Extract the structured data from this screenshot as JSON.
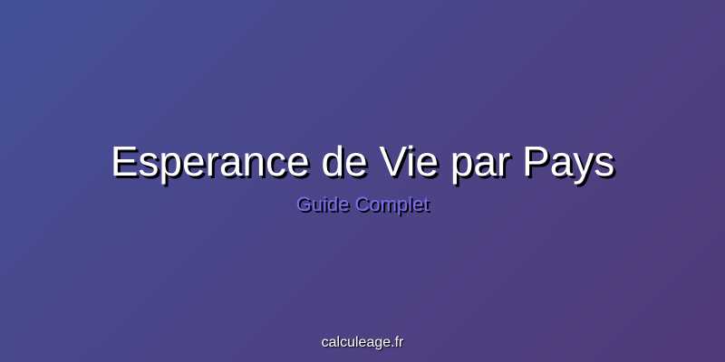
{
  "title": "Esperance de Vie par Pays",
  "subtitle": "Guide Complet",
  "footer": "calculeage.fr",
  "colors": {
    "background_start": "#44519a",
    "background_end": "#523a78",
    "title": "#ffffff",
    "subtitle": "#7c6cf0",
    "shadow": "#000000"
  }
}
